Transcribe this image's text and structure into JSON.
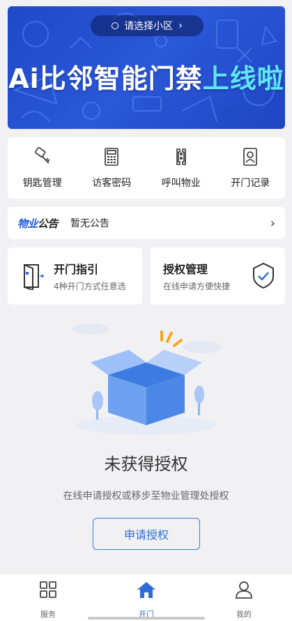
{
  "banner": {
    "community_selector": "请选择小区",
    "title_main": "Ai比邻智能门禁",
    "title_highlight": "上线啦"
  },
  "quick_actions": [
    {
      "label": "钥匙管理",
      "icon": "key-icon"
    },
    {
      "label": "访客密码",
      "icon": "keypad-icon"
    },
    {
      "label": "呼叫物业",
      "icon": "intercom-icon"
    },
    {
      "label": "开门记录",
      "icon": "record-icon"
    }
  ],
  "notice": {
    "tag_blue": "物业",
    "tag_dark": "公告",
    "text": "暂无公告"
  },
  "cards": {
    "guide": {
      "title": "开门指引",
      "subtitle": "4种开门方式任意选"
    },
    "auth": {
      "title": "授权管理",
      "subtitle": "在线申请方便快捷"
    }
  },
  "empty_state": {
    "title": "未获得授权",
    "description": "在线申请授权或移步至物业管理处授权",
    "button": "申请授权"
  },
  "tabbar": [
    {
      "label": "服务",
      "icon": "grid-icon",
      "active": false
    },
    {
      "label": "开门",
      "icon": "home-icon",
      "active": true
    },
    {
      "label": "我的",
      "icon": "person-icon",
      "active": false
    }
  ],
  "colors": {
    "accent": "#2d6cd6",
    "banner_bg": "#2553d2",
    "highlight": "#5fe6ff"
  }
}
